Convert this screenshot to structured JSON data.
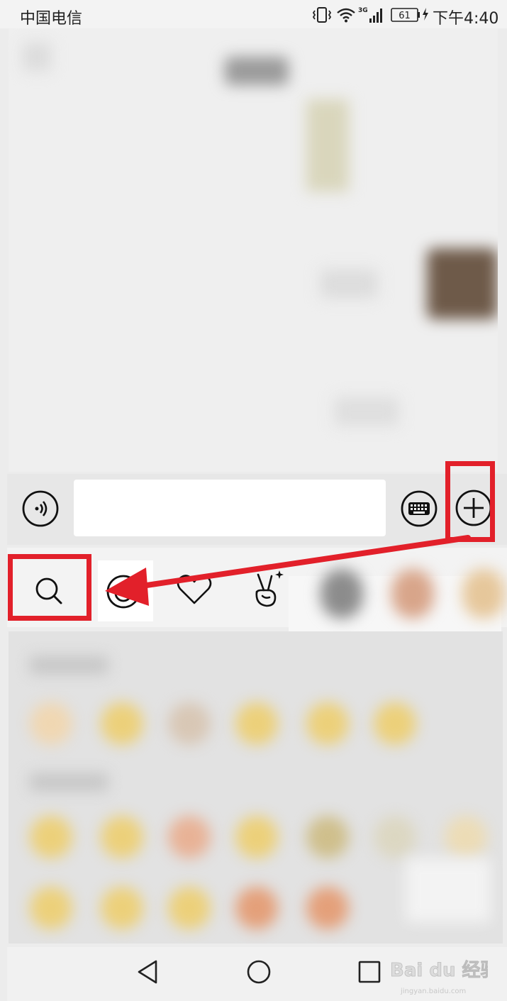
{
  "status_bar": {
    "carrier": "中国电信",
    "network_label": "3G",
    "battery_level": "61",
    "time": "下午4:40"
  },
  "chat": {
    "message_input": {
      "value": "",
      "placeholder": ""
    }
  },
  "input_bar": {
    "icons": [
      "voice-icon",
      "keyboard-icon",
      "plus-icon"
    ]
  },
  "emoji_tabs": {
    "icons": [
      "search-icon",
      "emoji-icon",
      "heart-icon",
      "victory-hand-icon"
    ]
  },
  "annotation": {
    "color": "#e2202a"
  },
  "watermark": {
    "text": "Bai du 经验",
    "url_text": "jingyan.baidu.com"
  },
  "nav_bar": {
    "icons": [
      "back-icon",
      "home-icon",
      "recents-icon"
    ]
  }
}
